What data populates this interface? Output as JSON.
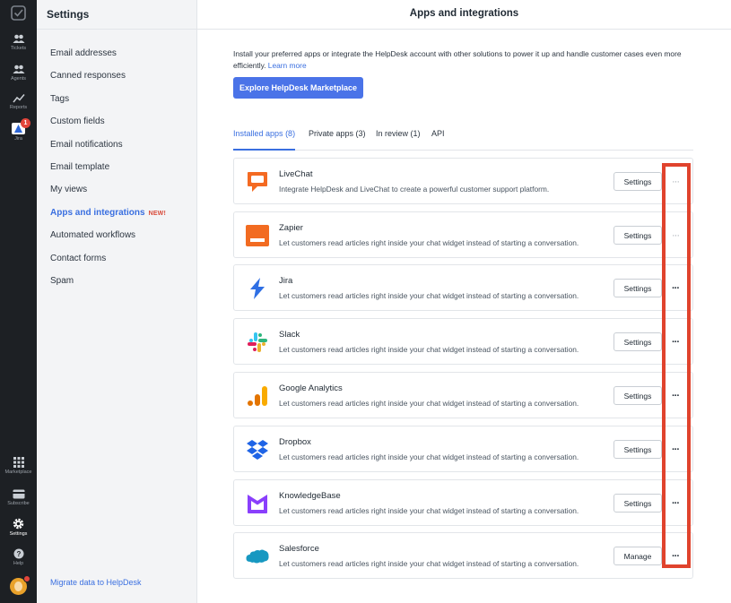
{
  "rail": {
    "items": [
      {
        "label": "Tickets"
      },
      {
        "label": "Agents"
      },
      {
        "label": "Reports"
      },
      {
        "label": "Jira",
        "badge": "1"
      },
      {
        "label": "Marketplace"
      },
      {
        "label": "Subscribe"
      },
      {
        "label": "Settings"
      },
      {
        "label": "Help"
      }
    ]
  },
  "sidebar": {
    "title": "Settings",
    "items": [
      {
        "label": "Email addresses"
      },
      {
        "label": "Canned responses"
      },
      {
        "label": "Tags"
      },
      {
        "label": "Custom fields"
      },
      {
        "label": "Email notifications"
      },
      {
        "label": "Email template"
      },
      {
        "label": "My views"
      },
      {
        "label": "Apps and integrations",
        "tag": "NEW!"
      },
      {
        "label": "Automated workflows"
      },
      {
        "label": "Contact forms"
      },
      {
        "label": "Spam"
      }
    ],
    "footer_link": "Migrate data to HelpDesk"
  },
  "main": {
    "title": "Apps and integrations",
    "intro_text": "Install your preferred apps or integrate the HelpDesk account with other solutions to power it up and handle customer cases even more efficiently.",
    "learn_more": "Learn more",
    "explore_button": "Explore HelpDesk Marketplace",
    "tabs": [
      {
        "label": "Installed apps",
        "count": "(8)"
      },
      {
        "label": "Private apps",
        "count": "(3)"
      },
      {
        "label": "In review",
        "count": "(1)"
      },
      {
        "label": "API",
        "count": ""
      }
    ],
    "more_glyph": "···",
    "apps": [
      {
        "name": "LiveChat",
        "desc": "Integrate HelpDesk and LiveChat to create a powerful customer support platform.",
        "button": "Settings",
        "icon": "livechat-logo"
      },
      {
        "name": "Zapier",
        "desc": "Let customers read articles right inside your chat widget instead of starting a conversation.",
        "button": "Settings",
        "icon": "zapier-logo"
      },
      {
        "name": "Jira",
        "desc": "Let customers read articles right inside your chat widget instead of starting a conversation.",
        "button": "Settings",
        "icon": "jira-logo"
      },
      {
        "name": "Slack",
        "desc": "Let customers read articles right inside your chat widget instead of starting a conversation.",
        "button": "Settings",
        "icon": "slack-logo"
      },
      {
        "name": "Google Analytics",
        "desc": "Let customers read articles right inside your chat widget instead of starting a conversation.",
        "button": "Settings",
        "icon": "google-analytics-logo"
      },
      {
        "name": "Dropbox",
        "desc": "Let customers read articles right inside your chat widget instead of starting a conversation.",
        "button": "Settings",
        "icon": "dropbox-logo"
      },
      {
        "name": "KnowledgeBase",
        "desc": "Let customers read articles right inside your chat widget instead of starting a conversation.",
        "button": "Settings",
        "icon": "knowledgebase-logo"
      },
      {
        "name": "Salesforce",
        "desc": "Let customers read articles right inside your chat widget instead of starting a conversation.",
        "button": "Manage",
        "icon": "salesforce-logo"
      }
    ]
  },
  "colors": {
    "accent": "#4a73e8",
    "highlight": "#e0432d",
    "rail": "#1d2024"
  }
}
